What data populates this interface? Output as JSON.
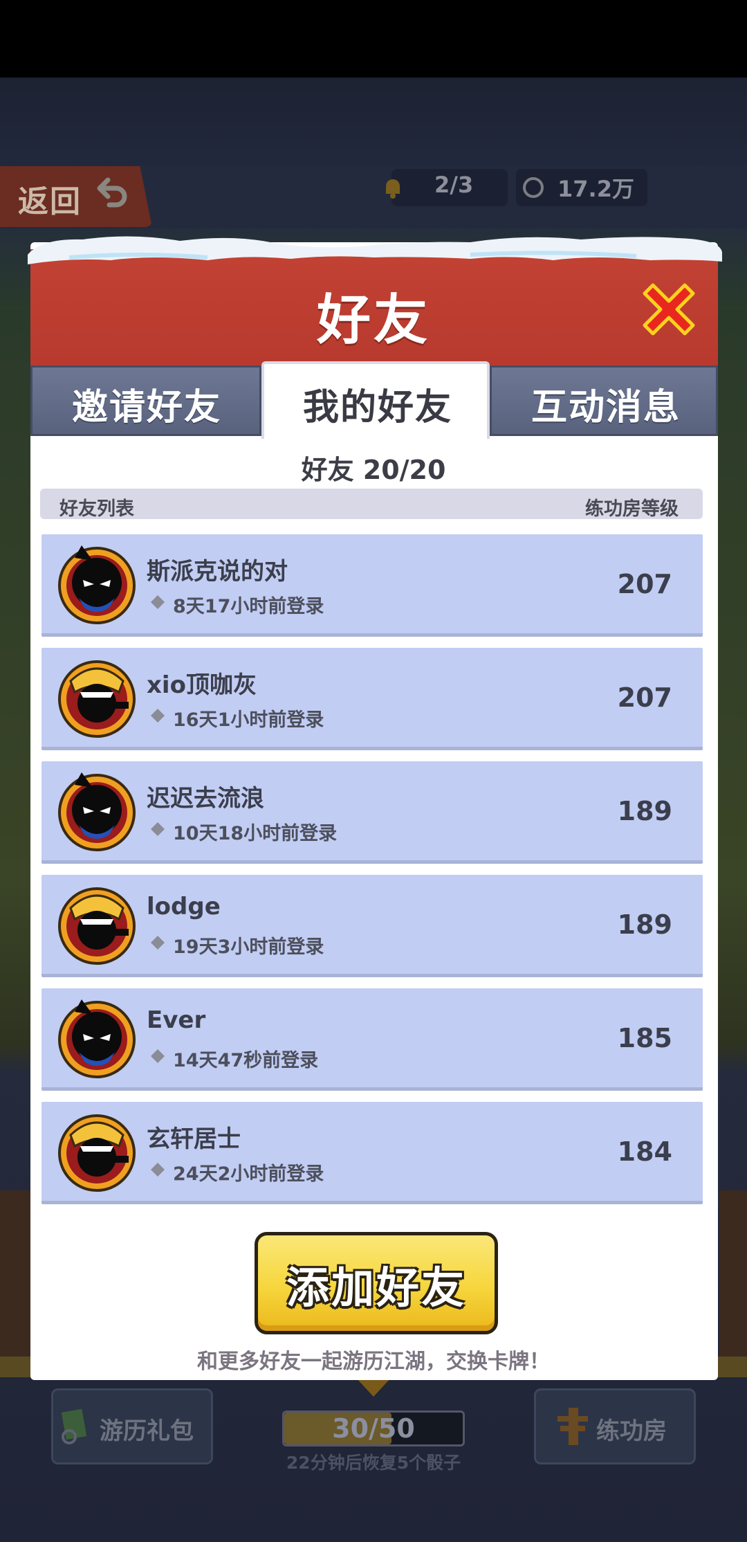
{
  "topbar": {
    "back_label": "返回",
    "energy_text": "2/3",
    "coins_text": "17.2万"
  },
  "modal": {
    "title": "好友",
    "tabs": [
      {
        "label": "邀请好友",
        "active": false
      },
      {
        "label": "我的好友",
        "active": true
      },
      {
        "label": "互动消息",
        "active": false
      }
    ],
    "count_label": "好友 20/20",
    "list_header": {
      "left": "好友列表",
      "right": "练功房等级"
    },
    "friends": [
      {
        "name": "斯派克说的对",
        "last_login": "8天17小时前登录",
        "level": "207",
        "avatar": "ninja-avatar"
      },
      {
        "name": "xio顶咖灰",
        "last_login": "16天1小时前登录",
        "level": "207",
        "avatar": "lion-dance-avatar"
      },
      {
        "name": "迟迟去流浪",
        "last_login": "10天18小时前登录",
        "level": "189",
        "avatar": "ninja-avatar"
      },
      {
        "name": "lodge",
        "last_login": "19天3小时前登录",
        "level": "189",
        "avatar": "lion-dance-avatar"
      },
      {
        "name": "Ever",
        "last_login": "14天47秒前登录",
        "level": "185",
        "avatar": "ninja-avatar"
      },
      {
        "name": "玄轩居士",
        "last_login": "24天2小时前登录",
        "level": "184",
        "avatar": "lion-dance-avatar"
      }
    ],
    "add_button_label": "添加好友",
    "footer_text": "和更多好友一起游历江湖，交换卡牌！"
  },
  "bottom_nav": {
    "gift_label": "游历礼包",
    "dice_progress": "30/50",
    "dice_progress_fraction": 0.6,
    "dice_subtext": "22分钟后恢复5个骰子",
    "train_label": "练功房"
  },
  "colors": {
    "header_red": "#c24234",
    "row_blue": "#c2cdf3",
    "button_yellow": "#f6d63c",
    "tab_inactive": "#6e7894"
  }
}
